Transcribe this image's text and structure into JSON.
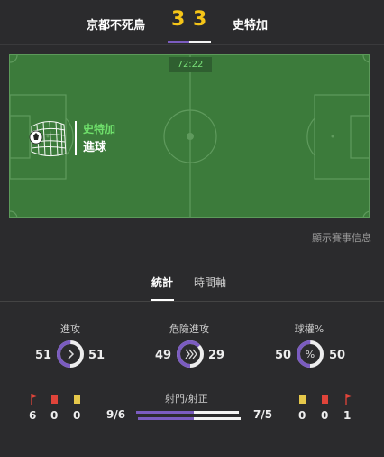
{
  "header": {
    "home_team": "京都不死鳥",
    "away_team": "史特加",
    "home_score": "3",
    "away_score": "3"
  },
  "pitch": {
    "timer": "72:22",
    "event_team": "史特加",
    "event_type": "進球"
  },
  "show_info_link": "顯示賽事信息",
  "tabs": [
    {
      "label": "統計",
      "active": true
    },
    {
      "label": "時間軸",
      "active": false
    }
  ],
  "stats": {
    "attack": {
      "label": "進攻",
      "home": "51",
      "away": "51",
      "home_fraction": 0.5
    },
    "dangerous_attack": {
      "label": "危險進攻",
      "home": "49",
      "away": "29",
      "home_fraction": 0.628
    },
    "possession": {
      "label": "球權%",
      "home": "50",
      "away": "50",
      "home_fraction": 0.5
    }
  },
  "home_counts": {
    "corners": "6",
    "red_cards": "0",
    "yellow_cards": "0"
  },
  "away_counts": {
    "yellow_cards": "0",
    "red_cards": "0",
    "corners": "1"
  },
  "shots": {
    "label": "射門/射正",
    "home": "9/6",
    "away": "7/5",
    "home_shots": 9,
    "away_shots": 7,
    "home_on_target": 6,
    "away_on_target": 5
  },
  "colors": {
    "accent_purple": "#7b5cc0",
    "score_yellow": "#f5c518",
    "pitch_green": "#3c7b3b",
    "event_green": "#6fe06b",
    "red_card": "#e0443a",
    "yellow_card": "#e6c84a"
  }
}
